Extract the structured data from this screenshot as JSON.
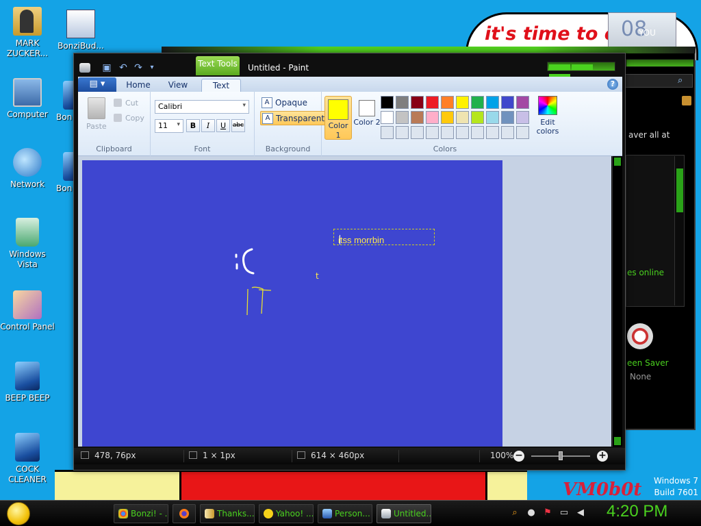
{
  "desktop": {
    "banner_text": "it's time to e",
    "banner_photo_glyph": "08",
    "banner_photo_label": "YOU",
    "watermark": {
      "os": "Windows 7",
      "build": "Build 7601"
    },
    "vm_logo": "VM0b0t",
    "icons": [
      {
        "label": "MARK ZUCKER...",
        "icon": "folder-icon"
      },
      {
        "label": "BonziBud...",
        "icon": "bonzi-shortcut-icon"
      },
      {
        "label": "Computer",
        "icon": "computer-icon"
      },
      {
        "label": "Bon",
        "icon": "app-icon"
      },
      {
        "label": "Network",
        "icon": "network-icon"
      },
      {
        "label": "Bon",
        "icon": "app-icon"
      },
      {
        "label": "Windows Vista",
        "icon": "recycle-bin-icon"
      },
      {
        "label": "Control Panel",
        "icon": "control-panel-icon"
      },
      {
        "label": "BEEP BEEP",
        "icon": "app-icon"
      },
      {
        "label": "COCK CLEANER",
        "icon": "app-icon"
      }
    ]
  },
  "back_window": {
    "text_top": "aver all at",
    "text_mid": "es online",
    "screen_saver_label": "een Saver",
    "screen_saver_value": "None"
  },
  "paint": {
    "window_title": "Untitled - Paint",
    "contextual_tab": "Text Tools",
    "tabs": [
      {
        "label": "Home"
      },
      {
        "label": "View"
      },
      {
        "label": "Text"
      }
    ],
    "active_tab": "Text",
    "clipboard": {
      "paste": "Paste",
      "cut": "Cut",
      "copy": "Copy",
      "label": "Clipboard"
    },
    "font": {
      "family": "Calibri",
      "size": "11",
      "bold": "B",
      "italic": "I",
      "underline": "U",
      "strike": "abc",
      "label": "Font"
    },
    "background": {
      "opaque": "Opaque",
      "transparent": "Transparent",
      "selected": "Transparent",
      "label": "Background"
    },
    "colors": {
      "color1_label": "Color 1",
      "color1_value": "#ffff00",
      "color2_label": "Color 2",
      "color2_value": "#ffffff",
      "edit_label": "Edit colors",
      "label": "Colors",
      "palette_row1": [
        "#000000",
        "#7f7f7f",
        "#880015",
        "#ed1c24",
        "#ff7f27",
        "#fff200",
        "#22b14c",
        "#00a2e8",
        "#3f48cc",
        "#a349a4"
      ],
      "palette_row2": [
        "#ffffff",
        "#c3c3c3",
        "#b97a57",
        "#ffaec9",
        "#ffc90e",
        "#efe4b0",
        "#b5e61d",
        "#99d9ea",
        "#7092be",
        "#c8bfe7"
      ],
      "palette_row3": [
        "#dde5ef",
        "#dde5ef",
        "#dde5ef",
        "#dde5ef",
        "#dde5ef",
        "#dde5ef",
        "#dde5ef",
        "#dde5ef",
        "#dde5ef",
        "#dde5ef"
      ]
    },
    "canvas": {
      "background_color": "#3e46d0",
      "text_box_value": "itss morrbin",
      "stray_text": "t"
    },
    "status": {
      "cursor_pos": "478, 76px",
      "selection_size": "1 × 1px",
      "canvas_size": "614 × 460px",
      "zoom": "100%"
    }
  },
  "taskbar": {
    "buttons": [
      {
        "label": "Bonzi! - ...",
        "icon": "chrome-icon"
      },
      {
        "label": "",
        "icon": "firefox-icon"
      },
      {
        "label": "Thanks...",
        "icon": "book-icon"
      },
      {
        "label": "Yahoo! ...",
        "icon": "yahoo-smiley-icon"
      },
      {
        "label": "Person...",
        "icon": "personalize-icon"
      },
      {
        "label": "Untitled...",
        "icon": "paint-icon"
      }
    ],
    "clock": "4:20 PM"
  }
}
